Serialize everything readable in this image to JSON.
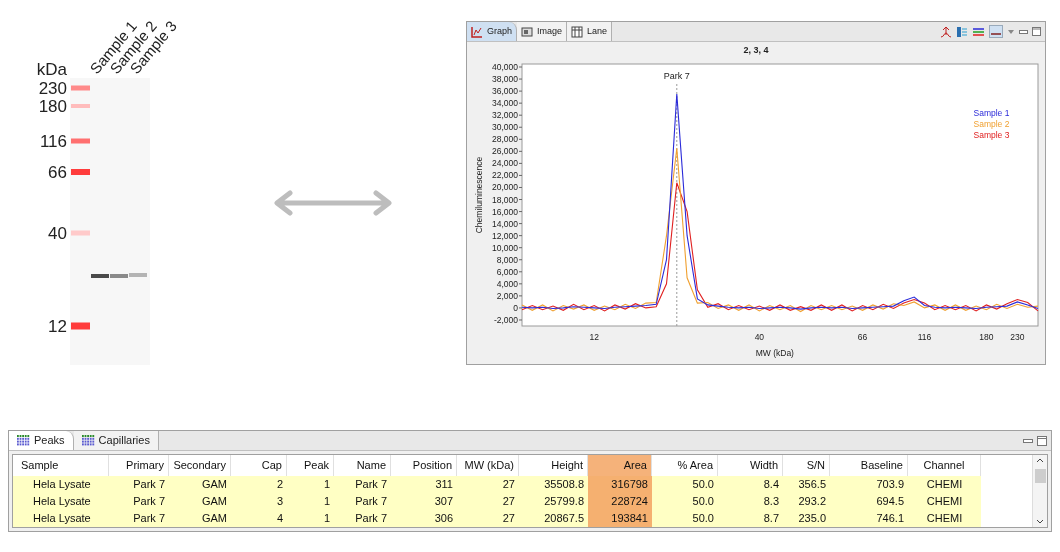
{
  "gel": {
    "unit_label": "kDa",
    "ladder": [
      {
        "label": "230"
      },
      {
        "label": "180"
      },
      {
        "label": "116"
      },
      {
        "label": "66"
      },
      {
        "label": "40"
      },
      {
        "label": "12"
      }
    ],
    "lanes": [
      {
        "label": "Sample 1"
      },
      {
        "label": "Sample 2"
      },
      {
        "label": "Sample 3"
      }
    ]
  },
  "graph_panel": {
    "tabs": [
      {
        "label": "Graph",
        "selected": true
      },
      {
        "label": "Image",
        "selected": false
      },
      {
        "label": "Lane",
        "selected": false
      }
    ],
    "chart_data": {
      "type": "line",
      "title": "2, 3, 4",
      "xlabel": "MW (kDa)",
      "ylabel": "Chemiluminescence",
      "categories": [
        null,
        null,
        null,
        null,
        null,
        null,
        null,
        "12",
        null,
        null,
        null,
        null,
        null,
        null,
        null,
        null,
        null,
        null,
        null,
        null,
        null,
        null,
        null,
        "40",
        null,
        null,
        null,
        null,
        null,
        null,
        null,
        null,
        null,
        "66",
        null,
        null,
        null,
        null,
        null,
        "116",
        null,
        null,
        null,
        null,
        null,
        "180",
        null,
        null,
        "230",
        null,
        null
      ],
      "series": [
        {
          "name": "Sample 1",
          "color": "#2b2bd9",
          "values": [
            100,
            0,
            100,
            -100,
            0,
            200,
            100,
            0,
            -100,
            100,
            200,
            300,
            400,
            600,
            8000,
            35500,
            12000,
            1500,
            500,
            300,
            100,
            0,
            100,
            -100,
            0,
            100,
            0,
            -200,
            0,
            100,
            0,
            100,
            -100,
            0,
            100,
            200,
            300,
            1200,
            1800,
            400,
            100,
            0,
            100,
            0,
            -100,
            100,
            200,
            300,
            1000,
            500,
            -100
          ]
        },
        {
          "name": "Sample 2",
          "color": "#f0a030",
          "values": [
            500,
            -400,
            500,
            -500,
            400,
            -200,
            500,
            -400,
            300,
            -300,
            600,
            -100,
            800,
            900,
            12000,
            26500,
            5000,
            800,
            900,
            -100,
            500,
            -400,
            500,
            -500,
            400,
            -300,
            400,
            -600,
            400,
            -300,
            400,
            -300,
            300,
            -400,
            500,
            -200,
            700,
            400,
            1000,
            0,
            500,
            -400,
            500,
            -400,
            300,
            -300,
            600,
            -100,
            600,
            100,
            300
          ]
        },
        {
          "name": "Sample 3",
          "color": "#e02020",
          "values": [
            -300,
            400,
            -300,
            300,
            -400,
            600,
            -300,
            400,
            -500,
            500,
            -200,
            700,
            0,
            200,
            4000,
            20800,
            16000,
            3000,
            100,
            700,
            -300,
            400,
            -300,
            300,
            -400,
            500,
            -400,
            200,
            -400,
            500,
            -400,
            500,
            -500,
            400,
            -300,
            600,
            -100,
            800,
            1400,
            800,
            -300,
            400,
            -300,
            400,
            -500,
            500,
            -200,
            700,
            1400,
            900,
            -500
          ]
        }
      ],
      "ylim": [
        -3000,
        40500
      ],
      "yticks": [
        {
          "value": -2000,
          "label": "-2,000"
        },
        {
          "value": 0,
          "label": "0"
        },
        {
          "value": 2000,
          "label": "2,000"
        },
        {
          "value": 4000,
          "label": "4,000"
        },
        {
          "value": 6000,
          "label": "6,000"
        },
        {
          "value": 8000,
          "label": "8,000"
        },
        {
          "value": 10000,
          "label": "10,000"
        },
        {
          "value": 12000,
          "label": "12,000"
        },
        {
          "value": 14000,
          "label": "14,000"
        },
        {
          "value": 16000,
          "label": "16,000"
        },
        {
          "value": 18000,
          "label": "18,000"
        },
        {
          "value": 20000,
          "label": "20,000"
        },
        {
          "value": 22000,
          "label": "22,000"
        },
        {
          "value": 24000,
          "label": "24,000"
        },
        {
          "value": 26000,
          "label": "26,000"
        },
        {
          "value": 28000,
          "label": "28,000"
        },
        {
          "value": 30000,
          "label": "30,000"
        },
        {
          "value": 32000,
          "label": "32,000"
        },
        {
          "value": 34000,
          "label": "34,000"
        },
        {
          "value": 36000,
          "label": "36,000"
        },
        {
          "value": 38000,
          "label": "38,000"
        },
        {
          "value": 40000,
          "label": "40,000"
        }
      ],
      "annotations": [
        "Park 7"
      ]
    }
  },
  "table_panel": {
    "tabs": [
      {
        "label": "Peaks",
        "selected": true
      },
      {
        "label": "Capillaries",
        "selected": false
      }
    ],
    "columns": [
      {
        "label": "Sample",
        "selected": false
      },
      {
        "label": "Primary",
        "selected": false
      },
      {
        "label": "Secondary",
        "selected": false
      },
      {
        "label": "Cap",
        "selected": false
      },
      {
        "label": "Peak",
        "selected": false
      },
      {
        "label": "Name",
        "selected": false
      },
      {
        "label": "Position",
        "selected": false
      },
      {
        "label": "MW (kDa)",
        "selected": false
      },
      {
        "label": "Height",
        "selected": false
      },
      {
        "label": "Area",
        "selected": true
      },
      {
        "label": "% Area",
        "selected": false
      },
      {
        "label": "Width",
        "selected": false
      },
      {
        "label": "S/N",
        "selected": false
      },
      {
        "label": "Baseline",
        "selected": false
      },
      {
        "label": "Channel",
        "selected": false
      }
    ],
    "rows": [
      [
        "Hela Lysate",
        "Park 7",
        "GAM",
        "2",
        "1",
        "Park 7",
        "311",
        "27",
        "35508.8",
        "316798",
        "50.0",
        "8.4",
        "356.5",
        "703.9",
        "CHEMI"
      ],
      [
        "Hela Lysate",
        "Park 7",
        "GAM",
        "3",
        "1",
        "Park 7",
        "307",
        "27",
        "25799.8",
        "228724",
        "50.0",
        "8.3",
        "293.2",
        "694.5",
        "CHEMI"
      ],
      [
        "Hela Lysate",
        "Park 7",
        "GAM",
        "4",
        "1",
        "Park 7",
        "306",
        "27",
        "20867.5",
        "193841",
        "50.0",
        "8.7",
        "235.0",
        "746.1",
        "CHEMI"
      ]
    ]
  }
}
